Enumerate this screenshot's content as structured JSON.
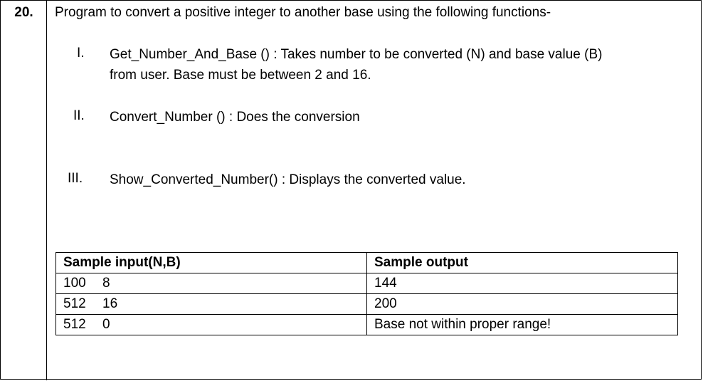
{
  "question": {
    "number": "20.",
    "intro": "Program to convert a positive integer to another base using the following functions-",
    "items": [
      {
        "numeral": "I.",
        "line1": "Get_Number_And_Base () : Takes number to be converted (N) and base value (B)",
        "line2": "from user. Base must be between 2 and 16."
      },
      {
        "numeral": "II.",
        "line1": "Convert_Number () :  Does the conversion"
      },
      {
        "numeral": "III.",
        "line1": "Show_Converted_Number() : Displays the converted value."
      }
    ]
  },
  "sample_table": {
    "headers": [
      "Sample input(N,B)",
      "Sample output"
    ],
    "rows": [
      {
        "n": "100",
        "b": "8",
        "output": "144"
      },
      {
        "n": "512",
        "b": "16",
        "output": "200"
      },
      {
        "n": "512",
        "b": "0",
        "output": "Base not within proper range!"
      }
    ]
  }
}
